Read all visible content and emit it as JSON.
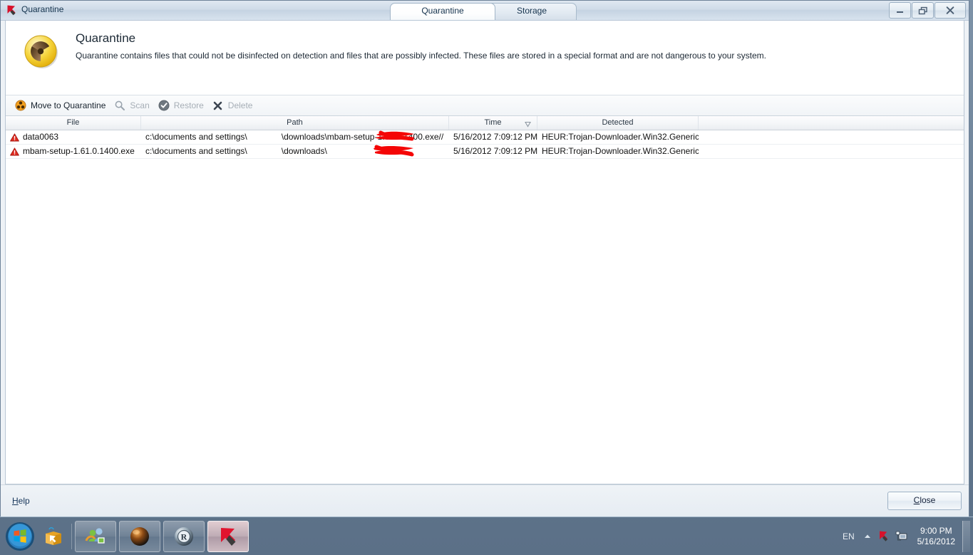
{
  "window": {
    "title": "Quarantine",
    "icon": "kaspersky-logo-icon",
    "buttons": {
      "minimize": "minimize-icon",
      "restore": "restore-icon",
      "close": "close-icon"
    }
  },
  "tabs": [
    {
      "label": "Quarantine",
      "active": true
    },
    {
      "label": "Storage",
      "active": false
    }
  ],
  "banner": {
    "icon": "radiation-icon",
    "title": "Quarantine",
    "description": "Quarantine contains files that could not be disinfected on detection and files that are possibly infected. These files are stored in a special format and are not dangerous to your system."
  },
  "toolbar": [
    {
      "label": "Move to Quarantine",
      "icon": "biohazard-icon",
      "enabled": true
    },
    {
      "label": "Scan",
      "icon": "magnifier-icon",
      "enabled": false
    },
    {
      "label": "Restore",
      "icon": "restore-check-icon",
      "enabled": false
    },
    {
      "label": "Delete",
      "icon": "x-mark-icon",
      "enabled": false
    }
  ],
  "table": {
    "columns": [
      {
        "label": "File",
        "sort": ""
      },
      {
        "label": "Path",
        "sort": ""
      },
      {
        "label": "Time",
        "sort": "descending"
      },
      {
        "label": "Detected",
        "sort": ""
      },
      {
        "label": "",
        "sort": ""
      }
    ],
    "rows": [
      {
        "icon": "warning-triangle-icon",
        "file": "data0063",
        "path_before": "c:\\documents and settings\\",
        "path_after": "\\downloads\\mbam-setup-1.61.0.1400.exe//",
        "redacted": true,
        "time": "5/16/2012 7:09:12 PM",
        "detected": "HEUR:Trojan-Downloader.Win32.Generic"
      },
      {
        "icon": "warning-triangle-icon",
        "file": "mbam-setup-1.61.0.1400.exe",
        "path_before": "c:\\documents and settings\\",
        "path_after": "\\downloads\\",
        "redacted": true,
        "time": "5/16/2012 7:09:12 PM",
        "detected": "HEUR:Trojan-Downloader.Win32.Generic"
      }
    ]
  },
  "footer": {
    "help_label": "Help",
    "help_accel": "H",
    "close_label": "Close",
    "close_accel": "C"
  },
  "taskbar": {
    "start": "windows-start-orb-icon",
    "quicklaunch": [
      {
        "icon": "kaspersky-box-icon"
      }
    ],
    "tasks": [
      {
        "icon": "messenger-people-icon",
        "active": false
      },
      {
        "icon": "dark-sphere-icon",
        "active": false
      },
      {
        "icon": "revo-r-sphere-icon",
        "active": false
      },
      {
        "icon": "kaspersky-k-icon",
        "active": true
      }
    ],
    "tray": {
      "language": "EN",
      "chevron": "show-hidden-icons-chevron",
      "icons": [
        "kaspersky-tray-icon",
        "network-tray-icon"
      ],
      "time": "9:00 PM",
      "date": "5/16/2012"
    }
  },
  "colors": {
    "accent_red": "#d01a1a",
    "redaction": "#f00000",
    "title_text": "#16354f"
  }
}
